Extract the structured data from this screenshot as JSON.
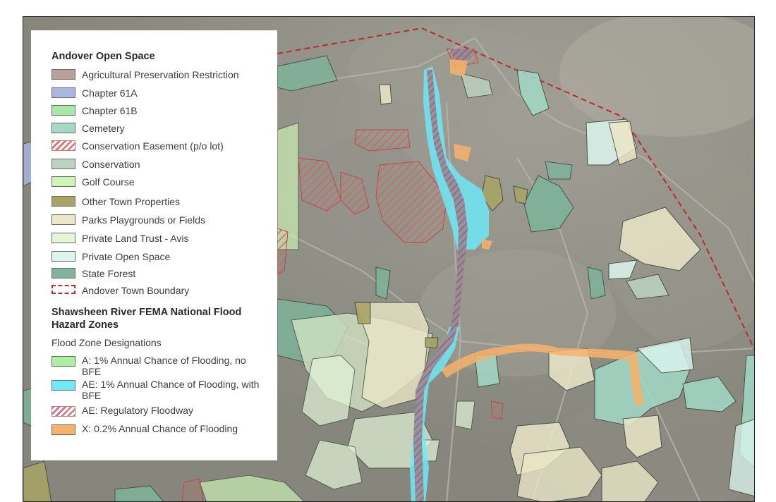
{
  "legend": {
    "open_space_title": "Andover Open Space",
    "open_space_items": [
      {
        "label": "Agricultural Preservation Restriction",
        "color": "#b9a09a",
        "pattern": "solid"
      },
      {
        "label": "Chapter 61A",
        "color": "#a9b6de",
        "pattern": "solid"
      },
      {
        "label": "Chapter 61B",
        "color": "#a9e8a4",
        "pattern": "solid"
      },
      {
        "label": "Cemetery",
        "color": "#a3d9c7",
        "pattern": "solid"
      },
      {
        "label": "Conservation Easement (p/o lot)",
        "color": "#d8736e",
        "pattern": "hatch"
      },
      {
        "label": "Conservation",
        "color": "#bdd3c1",
        "pattern": "solid"
      },
      {
        "label": "Golf Course",
        "color": "#cff5b6",
        "pattern": "solid"
      },
      {
        "label": "Other Town Properties",
        "color": "#a9a466",
        "pattern": "solid"
      },
      {
        "label": "Parks Playgrounds or Fields",
        "color": "#ebe6c8",
        "pattern": "solid"
      },
      {
        "label": "Private Land Trust - Avis",
        "color": "#e3f4d8",
        "pattern": "solid"
      },
      {
        "label": "Private Open Space",
        "color": "#dcf6ef",
        "pattern": "solid"
      },
      {
        "label": "State Forest",
        "color": "#7fb39a",
        "pattern": "solid"
      },
      {
        "label": "Andover Town Boundary",
        "color": "#c0272d",
        "pattern": "dashed"
      }
    ],
    "flood_title": "Shawsheen River FEMA National Flood Hazard Zones",
    "flood_subtitle": "Flood Zone Designations",
    "flood_items": [
      {
        "label": "A: 1% Annual Chance of Flooding, no BFE",
        "color": "#a9f0a0",
        "pattern": "solid"
      },
      {
        "label": "AE: 1% Annual Chance of Flooding, with BFE",
        "color": "#6fe8f7",
        "pattern": "solid"
      },
      {
        "label": "AE: Regulatory Floodway",
        "color": "#c77a85",
        "pattern": "hatch"
      },
      {
        "label": "X: 0.2% Annual Chance of Flooding",
        "color": "#f7b26a",
        "pattern": "solid"
      }
    ]
  }
}
